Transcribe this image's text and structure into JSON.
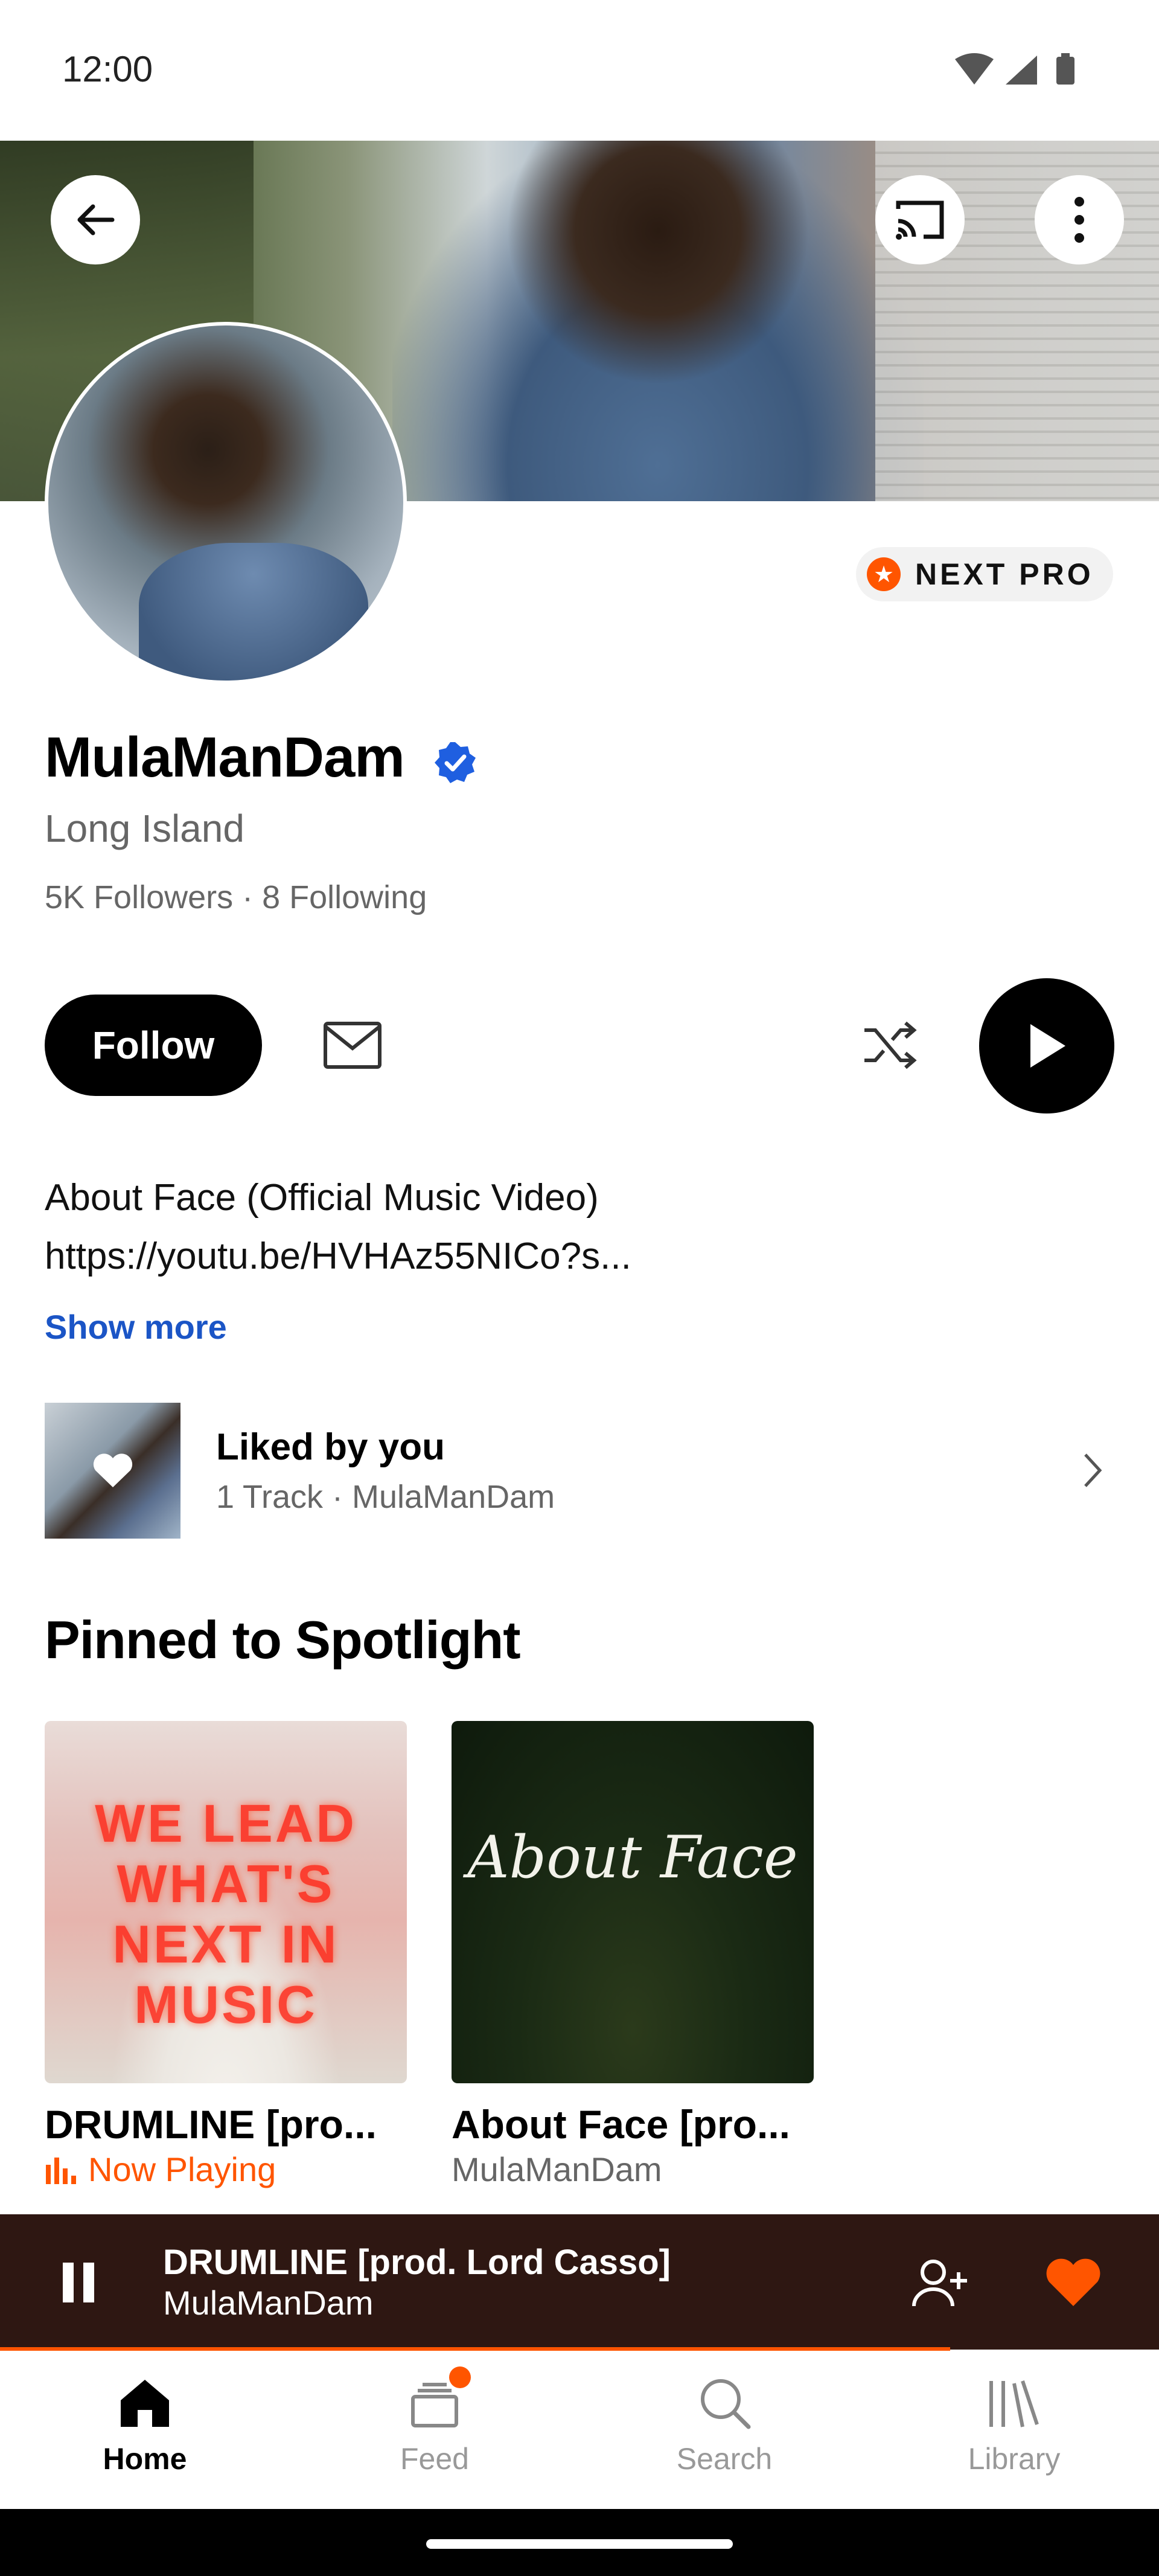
{
  "status_bar": {
    "time": "12:00"
  },
  "profile": {
    "name": "MulaManDam",
    "location": "Long Island",
    "stats": "5K Followers · 8 Following",
    "badge_text": "NEXT PRO",
    "follow_label": "Follow",
    "description_line1": "About Face (Official Music Video)",
    "description_line2": "https://youtu.be/HVHAz55NICo?s...",
    "show_more_label": "Show more"
  },
  "liked": {
    "title": "Liked by you",
    "subtitle": "1 Track · MulaManDam"
  },
  "spotlight": {
    "section_title": "Pinned to Spotlight",
    "cards": [
      {
        "title": "DRUMLINE [pro...",
        "status": "Now Playing",
        "art_text": "WE LEAD WHAT'S NEXT IN MUSIC"
      },
      {
        "title": "About Face [pro...",
        "subtitle": "MulaManDam",
        "art_text": "About Face"
      }
    ]
  },
  "mini_player": {
    "title": "DRUMLINE [prod. Lord Casso]",
    "artist": "MulaManDam",
    "progress": 0.82
  },
  "nav": {
    "items": [
      {
        "label": "Home",
        "icon": "home-icon",
        "active": true
      },
      {
        "label": "Feed",
        "icon": "feed-icon",
        "badge": true
      },
      {
        "label": "Search",
        "icon": "search-icon"
      },
      {
        "label": "Library",
        "icon": "library-icon"
      }
    ]
  },
  "colors": {
    "accent": "#ff5500",
    "link": "#1b55c6",
    "player_bg": "#2e1712",
    "verified": "#1f5fe0"
  }
}
